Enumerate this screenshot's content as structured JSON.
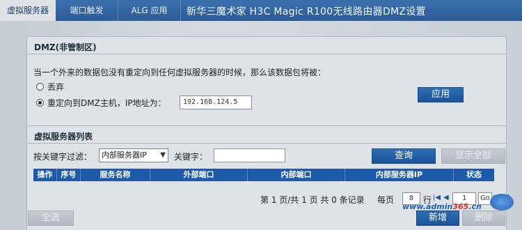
{
  "tabs": [
    {
      "label": "虚拟服务器",
      "active": true
    },
    {
      "label": "端口触发",
      "active": false
    },
    {
      "label": "ALG 应用",
      "active": false
    }
  ],
  "overlay_title": "新华三魔术家 H3C Magic R100无线路由器DMZ设置",
  "dmz": {
    "title": "DMZ(非管制区)",
    "description": "当一个外来的数据包没有重定向到任何虚拟服务器的时候，那么该数据包将被：",
    "option_discard": "丢弃",
    "option_redirect": "重定向到DMZ主机，IP地址为：",
    "selected": "redirect",
    "ip_value": "192.168.124.5",
    "apply_label": "应用"
  },
  "vs_list": {
    "title": "虚拟服务器列表",
    "filter_label": "按关键字过滤：",
    "filter_select_value": "内部服务器IP",
    "keyword_label": "关键字：",
    "keyword_value": "",
    "query_label": "查询",
    "show_all_label": "显示全部",
    "columns": [
      "操作",
      "序号",
      "服务名称",
      "外部端口",
      "内部端口",
      "内部服务器IP",
      "状态"
    ],
    "rows": []
  },
  "pagination": {
    "summary": "第 1 页/共 1 页 共 0 条记录",
    "per_page_label": "每页",
    "per_page_value": "8",
    "rows_label": "行",
    "page_value": "1",
    "go_label": "Go"
  },
  "footer": {
    "select_all_label": "全选",
    "add_label": "新增",
    "delete_label": "删除"
  },
  "watermark": {
    "part1": "www.",
    "part2": "admin",
    "part3": "365",
    "part4": ".cn"
  },
  "colors": {
    "tab_bar": "#2f62a3",
    "header_blue": "#1f5aa8",
    "button_blue": "#2563ab"
  }
}
